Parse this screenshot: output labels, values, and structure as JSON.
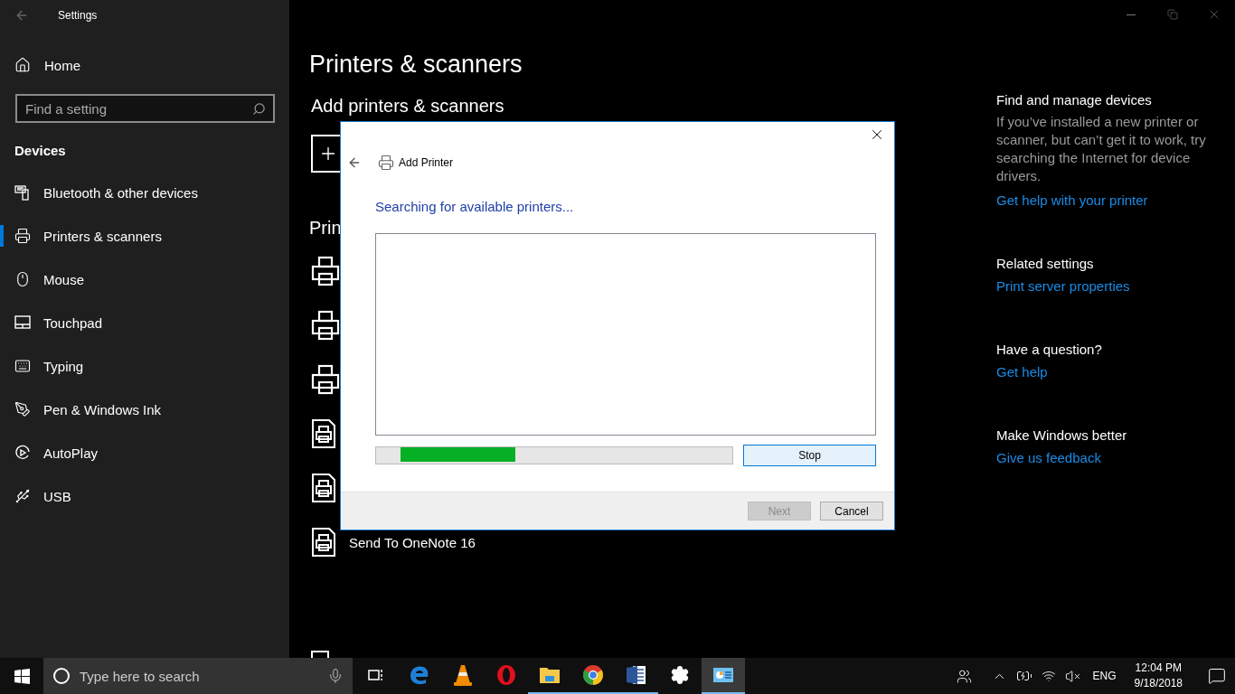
{
  "window": {
    "title": "Settings"
  },
  "sidebar": {
    "home": "Home",
    "search": {
      "placeholder": "Find a setting"
    },
    "section": "Devices",
    "items": [
      {
        "label": "Bluetooth & other devices",
        "selected": false
      },
      {
        "label": "Printers & scanners",
        "selected": true
      },
      {
        "label": "Mouse",
        "selected": false
      },
      {
        "label": "Touchpad",
        "selected": false
      },
      {
        "label": "Typing",
        "selected": false
      },
      {
        "label": "Pen & Windows Ink",
        "selected": false
      },
      {
        "label": "AutoPlay",
        "selected": false
      },
      {
        "label": "USB",
        "selected": false
      }
    ]
  },
  "page": {
    "title": "Printers & scanners",
    "add_heading": "Add printers & scanners",
    "list_heading": "Prin",
    "printers": [
      {
        "kind": "printer"
      },
      {
        "kind": "printer"
      },
      {
        "kind": "printer"
      },
      {
        "kind": "document"
      },
      {
        "kind": "document"
      },
      {
        "kind": "document",
        "name": "Send To OneNote 16"
      }
    ],
    "default_checkbox": {
      "checked": false
    }
  },
  "related": [
    {
      "heading": "Find and manage devices",
      "text": "If you’ve installed a new printer or scanner, but can’t get it to work, try searching the Internet for device drivers.",
      "link": "Get help with your printer"
    },
    {
      "heading": "Related settings",
      "link": "Print server properties"
    },
    {
      "heading": "Have a question?",
      "link": "Get help"
    },
    {
      "heading": "Make Windows better",
      "link": "Give us feedback"
    }
  ],
  "dialog": {
    "title": "Add Printer",
    "heading": "Searching for available printers...",
    "stop": "Stop",
    "buttons": [
      {
        "label": "Next",
        "disabled": true
      },
      {
        "label": "Cancel",
        "disabled": false
      }
    ]
  },
  "taskbar": {
    "search": {
      "placeholder": "Type here to search"
    },
    "apps": [
      {
        "running": false,
        "active": false
      },
      {
        "running": false,
        "active": false
      },
      {
        "running": false,
        "active": false
      },
      {
        "running": true,
        "active": false
      },
      {
        "running": true,
        "active": false
      },
      {
        "running": true,
        "active": false
      },
      {
        "running": false,
        "active": false
      },
      {
        "running": true,
        "active": true
      }
    ],
    "language": "ENG",
    "time": "12:04 PM",
    "date": "9/18/2018"
  }
}
